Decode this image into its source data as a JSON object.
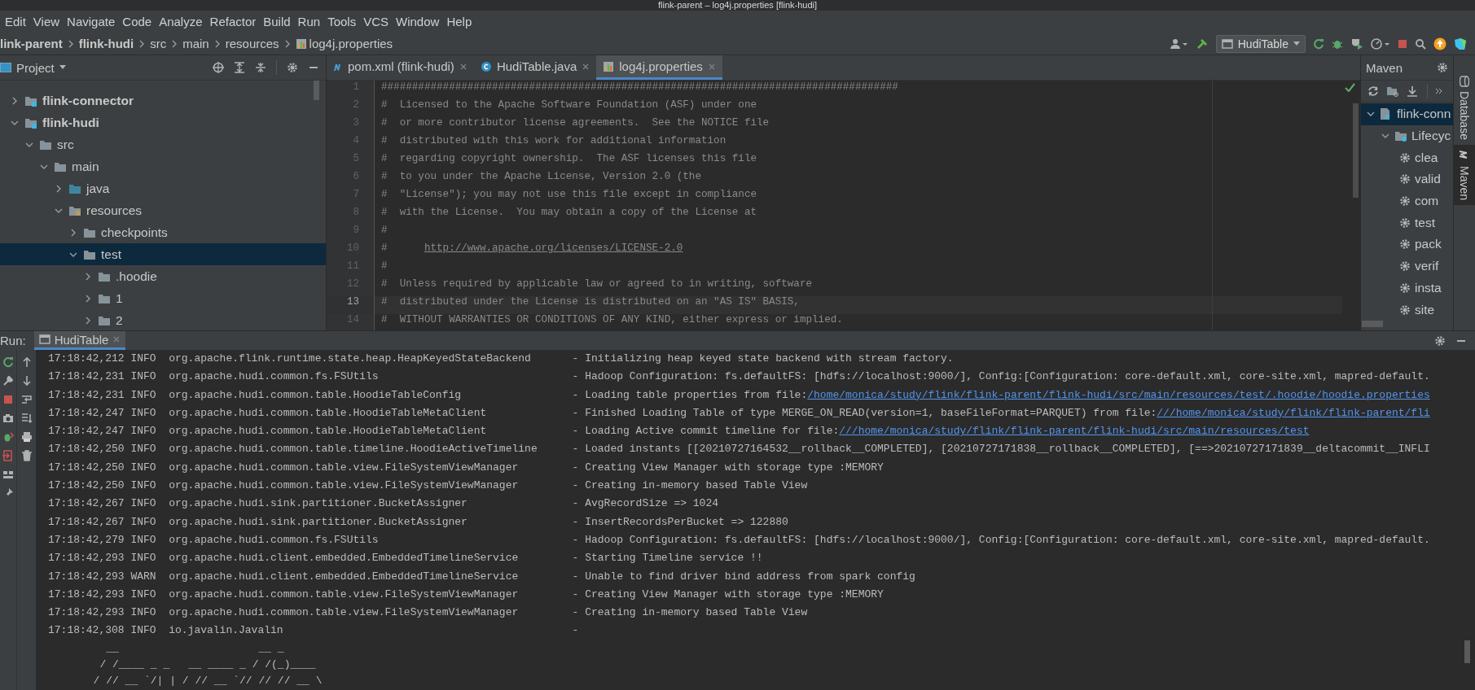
{
  "window": {
    "title": "flink-parent – log4j.properties [flink-hudi]"
  },
  "menu": [
    "Edit",
    "View",
    "Navigate",
    "Code",
    "Analyze",
    "Refactor",
    "Build",
    "Run",
    "Tools",
    "VCS",
    "Window",
    "Help"
  ],
  "breadcrumb": [
    {
      "label": "link-parent",
      "kind": "module"
    },
    {
      "label": "flink-hudi",
      "kind": "module"
    },
    {
      "label": "src",
      "kind": "folder"
    },
    {
      "label": "main",
      "kind": "folder"
    },
    {
      "label": "resources",
      "kind": "folder"
    },
    {
      "label": "log4j.properties",
      "kind": "properties"
    }
  ],
  "toolbar": {
    "run_config": "HudiTable"
  },
  "project": {
    "title": "Project",
    "tree": [
      {
        "label": "flink-connector",
        "kind": "module",
        "expanded": false,
        "selected": false
      },
      {
        "label": "flink-hudi",
        "kind": "module",
        "expanded": true,
        "selected": false,
        "children": [
          {
            "label": "src",
            "kind": "folder",
            "expanded": true,
            "selected": false,
            "children": [
              {
                "label": "main",
                "kind": "folder",
                "expanded": true,
                "selected": false,
                "children": [
                  {
                    "label": "java",
                    "kind": "source",
                    "expanded": false,
                    "selected": false
                  },
                  {
                    "label": "resources",
                    "kind": "resources",
                    "expanded": true,
                    "selected": false,
                    "children": [
                      {
                        "label": "checkpoints",
                        "kind": "folder",
                        "expanded": false,
                        "selected": false
                      },
                      {
                        "label": "test",
                        "kind": "folder",
                        "expanded": true,
                        "selected": true,
                        "children": [
                          {
                            "label": ".hoodie",
                            "kind": "folder",
                            "expanded": false,
                            "selected": false
                          },
                          {
                            "label": "1",
                            "kind": "folder",
                            "expanded": false,
                            "selected": false
                          },
                          {
                            "label": "2",
                            "kind": "folder",
                            "expanded": false,
                            "selected": false
                          }
                        ]
                      }
                    ]
                  }
                ]
              }
            ]
          }
        ]
      }
    ]
  },
  "editor": {
    "tabs": [
      {
        "label": "pom.xml (flink-hudi)",
        "kind": "maven",
        "selected": false
      },
      {
        "label": "HudiTable.java",
        "kind": "class",
        "selected": false
      },
      {
        "label": "log4j.properties",
        "kind": "properties",
        "selected": true
      }
    ],
    "lines": [
      {
        "number": "1",
        "text": "####################################################################################",
        "current": false
      },
      {
        "number": "2",
        "text": "#  Licensed to the Apache Software Foundation (ASF) under one",
        "current": false
      },
      {
        "number": "3",
        "text": "#  or more contributor license agreements.  See the NOTICE file",
        "current": false
      },
      {
        "number": "4",
        "text": "#  distributed with this work for additional information",
        "current": false
      },
      {
        "number": "5",
        "text": "#  regarding copyright ownership.  The ASF licenses this file",
        "current": false
      },
      {
        "number": "6",
        "text": "#  to you under the Apache License, Version 2.0 (the",
        "current": false
      },
      {
        "number": "7",
        "text": "#  \"License\"); you may not use this file except in compliance",
        "current": false
      },
      {
        "number": "8",
        "text": "#  with the License.  You may obtain a copy of the License at",
        "current": false
      },
      {
        "number": "9",
        "text": "#",
        "current": false
      },
      {
        "number": "10",
        "text": "#",
        "link": "http://www.apache.org/licenses/LICENSE-2.0",
        "current": false
      },
      {
        "number": "11",
        "text": "#",
        "current": false
      },
      {
        "number": "12",
        "text": "#  Unless required by applicable law or agreed to in writing, software",
        "current": false
      },
      {
        "number": "13",
        "text": "#  distributed under the License is distributed on an \"AS IS\" BASIS,",
        "current": true
      },
      {
        "number": "14",
        "text": "#  WITHOUT WARRANTIES OR CONDITIONS OF ANY KIND, either express or implied.",
        "current": false
      }
    ]
  },
  "maven": {
    "title": "Maven",
    "tree": [
      {
        "label": "flink-conn",
        "kind": "module",
        "expanded": true,
        "selected": true,
        "children": [
          {
            "label": "Lifecyc",
            "kind": "lifecycle",
            "expanded": true,
            "selected": false,
            "children": [
              {
                "label": "clea",
                "kind": "goal",
                "selected": false
              },
              {
                "label": "valid",
                "kind": "goal",
                "selected": false
              },
              {
                "label": "com",
                "kind": "goal",
                "selected": false
              },
              {
                "label": "test",
                "kind": "goal",
                "selected": false
              },
              {
                "label": "pack",
                "kind": "goal",
                "selected": false
              },
              {
                "label": "verif",
                "kind": "goal",
                "selected": false
              },
              {
                "label": "insta",
                "kind": "goal",
                "selected": false
              },
              {
                "label": "site",
                "kind": "goal",
                "selected": false
              }
            ]
          }
        ]
      }
    ]
  },
  "right_stripe": [
    {
      "label": "Database",
      "kind": "database",
      "selected": false
    },
    {
      "label": "Maven",
      "kind": "maven",
      "selected": true
    }
  ],
  "run": {
    "label": "Run:",
    "tabs": [
      {
        "label": "HudiTable",
        "selected": true
      }
    ],
    "log": [
      {
        "time": "17:18:42,212",
        "level": "INFO",
        "logger": "org.apache.flink.runtime.state.heap.HeapKeyedStateBackend",
        "message": "- Initializing heap keyed state backend with stream factory."
      },
      {
        "time": "17:18:42,231",
        "level": "INFO",
        "logger": "org.apache.hudi.common.fs.FSUtils",
        "message": "- Hadoop Configuration: fs.defaultFS: [hdfs://localhost:9000/], Config:[Configuration: core-default.xml, core-site.xml, mapred-default."
      },
      {
        "time": "17:18:42,231",
        "level": "INFO",
        "logger": "org.apache.hudi.common.table.HoodieTableConfig",
        "message": "- Loading table properties from file:",
        "link": "/home/monica/study/flink/flink-parent/flink-hudi/src/main/resources/test/.hoodie/hoodie.properties"
      },
      {
        "time": "17:18:42,247",
        "level": "INFO",
        "logger": "org.apache.hudi.common.table.HoodieTableMetaClient",
        "message": "- Finished Loading Table of type MERGE_ON_READ(version=1, baseFileFormat=PARQUET) from file:",
        "link": "///home/monica/study/flink/flink-parent/fli"
      },
      {
        "time": "17:18:42,247",
        "level": "INFO",
        "logger": "org.apache.hudi.common.table.HoodieTableMetaClient",
        "message": "- Loading Active commit timeline for file:",
        "link": "///home/monica/study/flink/flink-parent/flink-hudi/src/main/resources/test"
      },
      {
        "time": "17:18:42,250",
        "level": "INFO",
        "logger": "org.apache.hudi.common.table.timeline.HoodieActiveTimeline",
        "message": "- Loaded instants [[20210727164532__rollback__COMPLETED], [20210727171838__rollback__COMPLETED], [==>20210727171839__deltacommit__INFLI"
      },
      {
        "time": "17:18:42,250",
        "level": "INFO",
        "logger": "org.apache.hudi.common.table.view.FileSystemViewManager",
        "message": "- Creating View Manager with storage type :MEMORY"
      },
      {
        "time": "17:18:42,250",
        "level": "INFO",
        "logger": "org.apache.hudi.common.table.view.FileSystemViewManager",
        "message": "- Creating in-memory based Table View"
      },
      {
        "time": "17:18:42,267",
        "level": "INFO",
        "logger": "org.apache.hudi.sink.partitioner.BucketAssigner",
        "message": "- AvgRecordSize => 1024"
      },
      {
        "time": "17:18:42,267",
        "level": "INFO",
        "logger": "org.apache.hudi.sink.partitioner.BucketAssigner",
        "message": "- InsertRecordsPerBucket => 122880"
      },
      {
        "time": "17:18:42,279",
        "level": "INFO",
        "logger": "org.apache.hudi.common.fs.FSUtils",
        "message": "- Hadoop Configuration: fs.defaultFS: [hdfs://localhost:9000/], Config:[Configuration: core-default.xml, core-site.xml, mapred-default."
      },
      {
        "time": "17:18:42,293",
        "level": "INFO",
        "logger": "org.apache.hudi.client.embedded.EmbeddedTimelineService",
        "message": "- Starting Timeline service !!"
      },
      {
        "time": "17:18:42,293",
        "level": "WARN",
        "logger": "org.apache.hudi.client.embedded.EmbeddedTimelineService",
        "message": "- Unable to find driver bind address from spark config"
      },
      {
        "time": "17:18:42,293",
        "level": "INFO",
        "logger": "org.apache.hudi.common.table.view.FileSystemViewManager",
        "message": "- Creating View Manager with storage type :MEMORY"
      },
      {
        "time": "17:18:42,293",
        "level": "INFO",
        "logger": "org.apache.hudi.common.table.view.FileSystemViewManager",
        "message": "- Creating in-memory based Table View"
      },
      {
        "time": "17:18:42,308",
        "level": "INFO",
        "logger": "io.javalin.Javalin",
        "message": "-"
      }
    ],
    "banner": [
      "    __                      __ _",
      "   / /____ _ _   __ ____ _ / /(_)____",
      "  / // __ `/| | / // __ `// // // __ \\"
    ]
  }
}
